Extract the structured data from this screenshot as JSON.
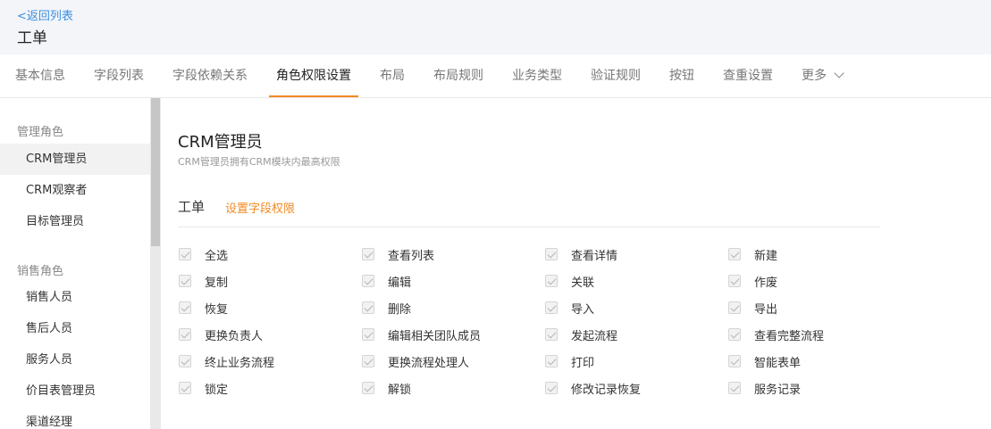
{
  "header": {
    "back_label": "<返回列表",
    "title": "工单"
  },
  "tabs": [
    {
      "label": "基本信息"
    },
    {
      "label": "字段列表"
    },
    {
      "label": "字段依赖关系"
    },
    {
      "label": "角色权限设置",
      "active": true
    },
    {
      "label": "布局"
    },
    {
      "label": "布局规则"
    },
    {
      "label": "业务类型"
    },
    {
      "label": "验证规则"
    },
    {
      "label": "按钮"
    },
    {
      "label": "查重设置"
    },
    {
      "label": "更多"
    }
  ],
  "sidebar": {
    "groups": [
      {
        "label": "管理角色",
        "items": [
          {
            "label": "CRM管理员",
            "active": true
          },
          {
            "label": "CRM观察者"
          },
          {
            "label": "目标管理员"
          }
        ]
      },
      {
        "label": "销售角色",
        "items": [
          {
            "label": "销售人员"
          },
          {
            "label": "售后人员"
          },
          {
            "label": "服务人员"
          },
          {
            "label": "价目表管理员"
          },
          {
            "label": "渠道经理"
          }
        ]
      }
    ]
  },
  "role": {
    "name": "CRM管理员",
    "description": "CRM管理员拥有CRM模块内最高权限"
  },
  "section": {
    "title": "工单",
    "field_permission_link": "设置字段权限"
  },
  "permissions": [
    [
      "全选",
      "查看列表",
      "查看详情",
      "新建"
    ],
    [
      "复制",
      "编辑",
      "关联",
      "作废"
    ],
    [
      "恢复",
      "删除",
      "导入",
      "导出"
    ],
    [
      "更换负责人",
      "编辑相关团队成员",
      "发起流程",
      "查看完整流程"
    ],
    [
      "终止业务流程",
      "更换流程处理人",
      "打印",
      "智能表单"
    ],
    [
      "锁定",
      "解锁",
      "修改记录恢复",
      "服务记录"
    ]
  ],
  "colors": {
    "accent": "#f08a24",
    "link": "#3b8fe0",
    "header_bg": "#f3f5f9"
  }
}
